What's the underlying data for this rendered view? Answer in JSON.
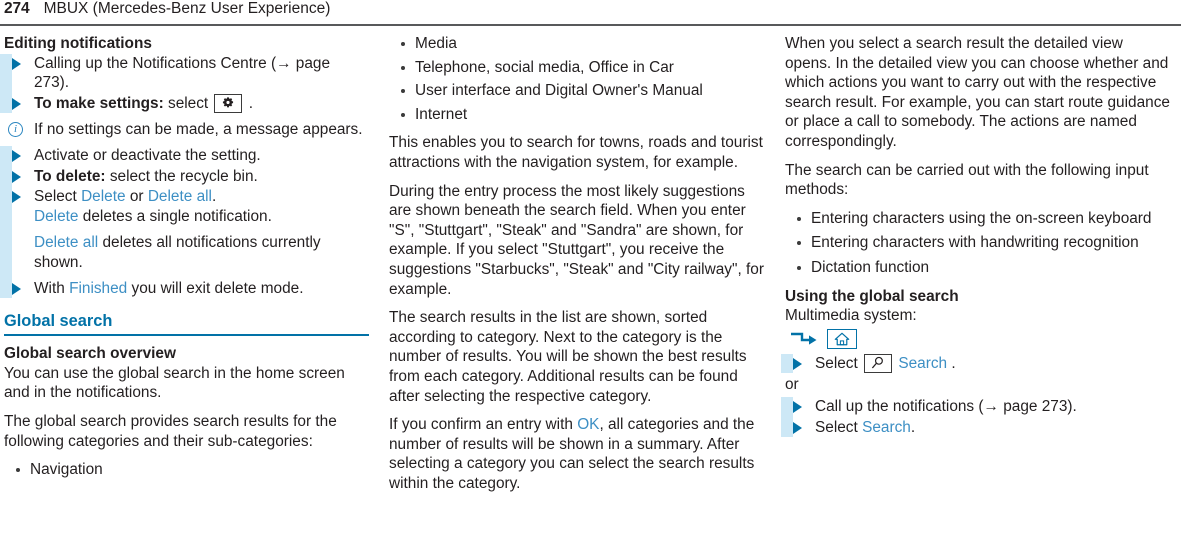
{
  "header": {
    "page_number": "274",
    "title": "MBUX (Mercedes-Benz User Experience)"
  },
  "colors": {
    "section_blue": "#0272a7",
    "link_blue": "#3d8fc4",
    "strip_blue": "#cde8f6",
    "body_text": "#231f20",
    "rule_gray": "#58595b"
  },
  "column_left": {
    "heading": "Editing notifications",
    "steps": [
      {
        "text": "Calling up the Notifications Centre (→ page 273)."
      },
      {
        "bold_prefix": "To make settings:",
        "text": " select ",
        "icon": "gear-icon",
        "suffix": " ."
      }
    ],
    "note": "If no settings can be made, a message appears.",
    "steps2": [
      {
        "text": "Activate or deactivate the setting."
      },
      {
        "bold_prefix": "To delete:",
        "text": " select the recycle bin."
      }
    ],
    "delete_step": {
      "lead": "Select ",
      "link1": "Delete",
      "mid": " or ",
      "link2": "Delete all",
      "end": ".",
      "line2_link": "Delete",
      "line2_rest": " deletes a single notification.",
      "line3_link": "Delete all",
      "line3_rest": " deletes all notifications currently shown."
    },
    "finished_step": {
      "lead": "With ",
      "link": "Finished",
      "rest": " you will exit delete mode."
    },
    "section_title": "Global search",
    "sub_heading": "Global search overview",
    "para1": "You can use the global search in the home screen and in the notifications.",
    "para2": "The global search provides search results for the following categories and their sub-categories:",
    "categories_part1": [
      "Navigation"
    ]
  },
  "column_middle": {
    "categories_part2": [
      "Media",
      "Telephone, social media, Office in Car",
      "User interface and Digital Owner's Manual",
      "Internet"
    ],
    "para1": "This enables you to search for towns, roads and tourist attractions with the navigation system, for example.",
    "para2": "During the entry process the most likely suggestions are shown beneath the search field. When you enter \"S\", \"Stuttgart\", \"Steak\" and \"Sandra\" are shown, for example. If you select \"Stuttgart\", you receive the suggestions \"Starbucks\", \"Steak\" and \"City railway\", for example.",
    "para3": "The search results in the list are shown, sorted according to category. Next to the category is the number of results. You will be shown the best results from each category. Additional results can be found after selecting the respective category.",
    "para4_pre": "If you confirm an entry with ",
    "para4_link": "OK",
    "para4_post": ", all categories and the number of results will be shown in a summary. After selecting a category you can select the search results within the category."
  },
  "column_right": {
    "para1": "When you select a search result the detailed view opens. In the detailed view you can choose whether and which actions you want to carry out with the respective search result. For example, you can start route guidance or place a call to somebody. The actions are named correspondingly.",
    "para2": "The search can be carried out with the following input methods:",
    "input_methods": [
      "Entering characters using the on-screen keyboard",
      "Entering characters with handwriting recognition",
      "Dictation function"
    ],
    "sub_heading": "Using the global search",
    "system_label": "Multimedia system:",
    "nav_path": {
      "arrow": "turn-arrow-icon",
      "icon": "home-icon"
    },
    "step_select_search": {
      "lead": "Select ",
      "icon": "search-icon",
      "link": "Search",
      "end": " ."
    },
    "or_word": "or",
    "step_notifications": "Call up the notifications (→ page 273).",
    "step_select_search2": {
      "lead": "Select ",
      "link": "Search",
      "end": "."
    }
  }
}
